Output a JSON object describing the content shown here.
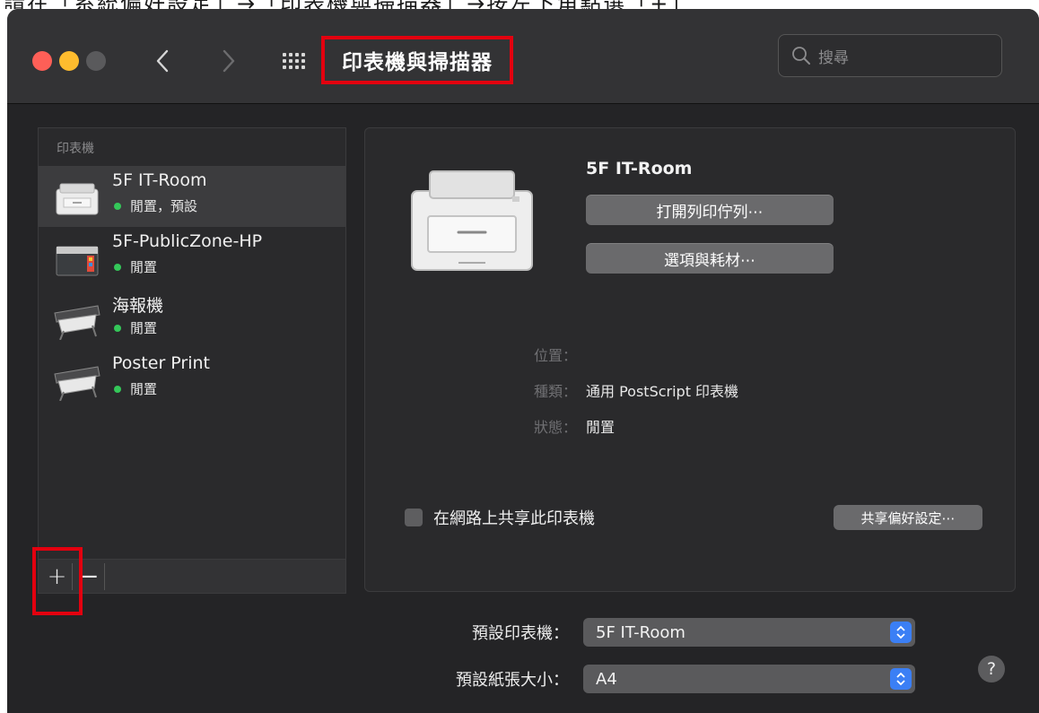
{
  "top_caption": "請在「系統偏好設定」→「印表機與掃描器」→按左下角點選「+」",
  "window": {
    "title": "印表機與掃描器"
  },
  "toolbar": {
    "back_icon": "chevron-left-icon",
    "forward_icon": "chevron-right-icon",
    "grid_icon": "show-all-grid-icon",
    "search_placeholder": "搜尋"
  },
  "sidebar": {
    "header": "印表機",
    "printers": [
      {
        "name": "5F IT-Room",
        "status": "閒置，預設",
        "icon": "laser-printer-icon",
        "selected": true
      },
      {
        "name": "5F-PublicZone-HP",
        "status": "閒置",
        "icon": "color-printer-icon",
        "selected": false
      },
      {
        "name": "海報機",
        "status": "閒置",
        "icon": "plotter-printer-icon",
        "selected": false
      },
      {
        "name": "Poster Print",
        "status": "閒置",
        "icon": "plotter-printer-icon",
        "selected": false
      }
    ],
    "add_label": "+",
    "remove_label": "−"
  },
  "detail": {
    "name": "5F IT-Room",
    "open_queue_label": "打開列印佇列⋯",
    "options_label": "選項與耗材⋯",
    "location_label": "位置：",
    "location_value": "",
    "kind_label": "種類：",
    "kind_value": "通用 PostScript 印表機",
    "status_label": "狀態：",
    "status_value": "閒置",
    "share_label": "在網路上共享此印表機",
    "share_checked": false,
    "share_prefs_label": "共享偏好設定⋯"
  },
  "defaults": {
    "default_printer_label": "預設印表機：",
    "default_printer_value": "5F IT-Room",
    "default_paper_label": "預設紙張大小：",
    "default_paper_value": "A4",
    "help_label": "?"
  },
  "colors": {
    "highlight": "#e3000f",
    "status_green": "#34c759",
    "accent_blue": "#3b7ff5"
  }
}
